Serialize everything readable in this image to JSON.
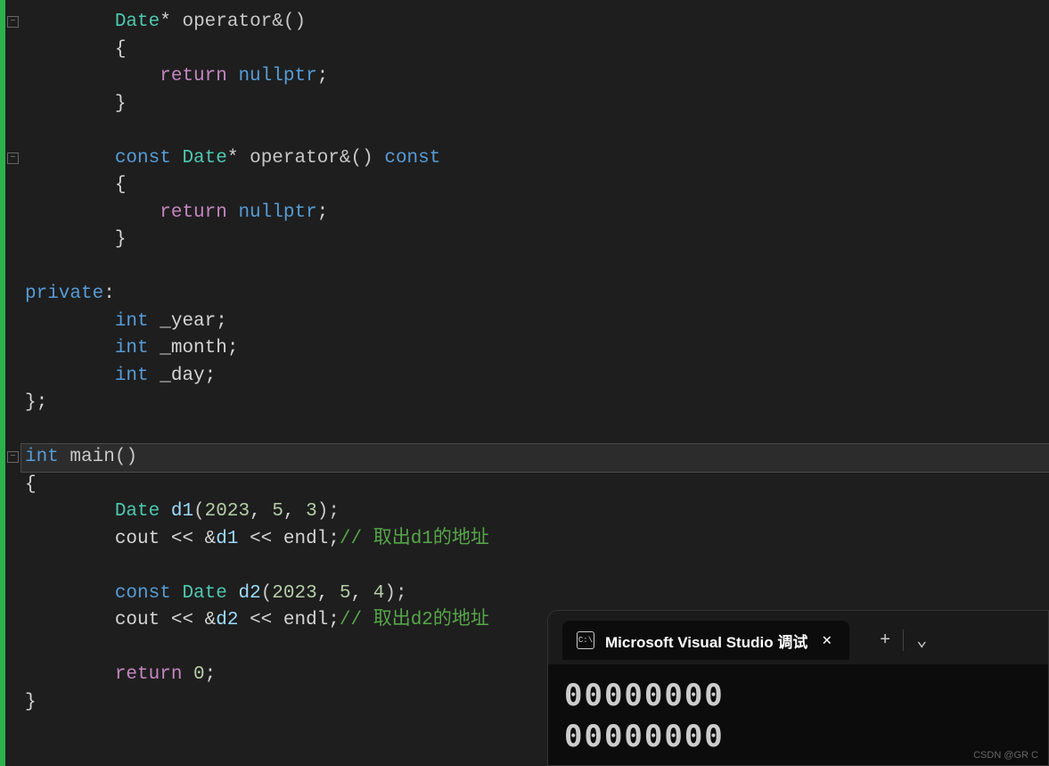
{
  "code": {
    "lines": [
      {
        "indent": 2,
        "segments": [
          {
            "t": "Date",
            "c": "kw-type"
          },
          {
            "t": "* ",
            "c": "kw-white"
          },
          {
            "t": "operator",
            "c": "kw-func"
          },
          {
            "t": "&()",
            "c": "kw-paren"
          }
        ]
      },
      {
        "indent": 2,
        "segments": [
          {
            "t": "{",
            "c": "kw-white"
          }
        ]
      },
      {
        "indent": 3,
        "segments": [
          {
            "t": "return ",
            "c": "kw-purple"
          },
          {
            "t": "nullptr",
            "c": "kw-blue"
          },
          {
            "t": ";",
            "c": "kw-white"
          }
        ]
      },
      {
        "indent": 2,
        "segments": [
          {
            "t": "}",
            "c": "kw-white"
          }
        ]
      },
      {
        "indent": 0,
        "segments": []
      },
      {
        "indent": 2,
        "segments": [
          {
            "t": "const ",
            "c": "kw-blue"
          },
          {
            "t": "Date",
            "c": "kw-type"
          },
          {
            "t": "* ",
            "c": "kw-white"
          },
          {
            "t": "operator",
            "c": "kw-func"
          },
          {
            "t": "&() ",
            "c": "kw-paren"
          },
          {
            "t": "const",
            "c": "kw-blue"
          }
        ]
      },
      {
        "indent": 2,
        "segments": [
          {
            "t": "{",
            "c": "kw-white"
          }
        ]
      },
      {
        "indent": 3,
        "segments": [
          {
            "t": "return ",
            "c": "kw-purple"
          },
          {
            "t": "nullptr",
            "c": "kw-blue"
          },
          {
            "t": ";",
            "c": "kw-white"
          }
        ]
      },
      {
        "indent": 2,
        "segments": [
          {
            "t": "}",
            "c": "kw-white"
          }
        ]
      },
      {
        "indent": 0,
        "segments": []
      },
      {
        "indent": 0,
        "segments": [
          {
            "t": "private",
            "c": "kw-blue"
          },
          {
            "t": ":",
            "c": "kw-white"
          }
        ]
      },
      {
        "indent": 2,
        "segments": [
          {
            "t": "int ",
            "c": "kw-blue"
          },
          {
            "t": "_year;",
            "c": "kw-white"
          }
        ]
      },
      {
        "indent": 2,
        "segments": [
          {
            "t": "int ",
            "c": "kw-blue"
          },
          {
            "t": "_month;",
            "c": "kw-white"
          }
        ]
      },
      {
        "indent": 2,
        "segments": [
          {
            "t": "int ",
            "c": "kw-blue"
          },
          {
            "t": "_day;",
            "c": "kw-white"
          }
        ]
      },
      {
        "indent": 0,
        "segments": [
          {
            "t": "};",
            "c": "kw-white"
          }
        ]
      },
      {
        "indent": 0,
        "segments": []
      },
      {
        "indent": 0,
        "segments": [
          {
            "t": "int ",
            "c": "kw-blue"
          },
          {
            "t": "main",
            "c": "kw-func"
          },
          {
            "t": "()",
            "c": "kw-paren"
          }
        ],
        "highlighted": true
      },
      {
        "indent": 0,
        "segments": [
          {
            "t": "{",
            "c": "kw-white"
          }
        ]
      },
      {
        "indent": 2,
        "segments": [
          {
            "t": "Date ",
            "c": "kw-type"
          },
          {
            "t": "d1",
            "c": "kw-var"
          },
          {
            "t": "(",
            "c": "kw-paren"
          },
          {
            "t": "2023",
            "c": "kw-number"
          },
          {
            "t": ", ",
            "c": "kw-white"
          },
          {
            "t": "5",
            "c": "kw-number"
          },
          {
            "t": ", ",
            "c": "kw-white"
          },
          {
            "t": "3",
            "c": "kw-number"
          },
          {
            "t": ");",
            "c": "kw-paren"
          }
        ]
      },
      {
        "indent": 2,
        "segments": [
          {
            "t": "cout << &",
            "c": "kw-white"
          },
          {
            "t": "d1",
            "c": "kw-var"
          },
          {
            "t": " << endl;",
            "c": "kw-white"
          },
          {
            "t": "// 取出d1的地址",
            "c": "kw-comment"
          }
        ]
      },
      {
        "indent": 0,
        "segments": []
      },
      {
        "indent": 2,
        "segments": [
          {
            "t": "const ",
            "c": "kw-blue"
          },
          {
            "t": "Date ",
            "c": "kw-type"
          },
          {
            "t": "d2",
            "c": "kw-var"
          },
          {
            "t": "(",
            "c": "kw-paren"
          },
          {
            "t": "2023",
            "c": "kw-number"
          },
          {
            "t": ", ",
            "c": "kw-white"
          },
          {
            "t": "5",
            "c": "kw-number"
          },
          {
            "t": ", ",
            "c": "kw-white"
          },
          {
            "t": "4",
            "c": "kw-number"
          },
          {
            "t": ");",
            "c": "kw-paren"
          }
        ]
      },
      {
        "indent": 2,
        "segments": [
          {
            "t": "cout << &",
            "c": "kw-white"
          },
          {
            "t": "d2",
            "c": "kw-var"
          },
          {
            "t": " << endl;",
            "c": "kw-white"
          },
          {
            "t": "// 取出d2的地址",
            "c": "kw-comment"
          }
        ]
      },
      {
        "indent": 0,
        "segments": []
      },
      {
        "indent": 2,
        "segments": [
          {
            "t": "return ",
            "c": "kw-purple"
          },
          {
            "t": "0",
            "c": "kw-number"
          },
          {
            "t": ";",
            "c": "kw-white"
          }
        ]
      },
      {
        "indent": 0,
        "segments": [
          {
            "t": "}",
            "c": "kw-white"
          }
        ]
      }
    ],
    "fold_markers": [
      {
        "line": 0,
        "symbol": "⊟"
      },
      {
        "line": 5,
        "symbol": "⊟"
      },
      {
        "line": 16,
        "symbol": "⊟"
      }
    ]
  },
  "console": {
    "icon_text": "C:\\",
    "title": "Microsoft Visual Studio 调试",
    "close": "✕",
    "plus": "+",
    "chevron": "⌄",
    "output": [
      "00000000",
      "00000000"
    ]
  },
  "watermark": "CSDN @GR C"
}
